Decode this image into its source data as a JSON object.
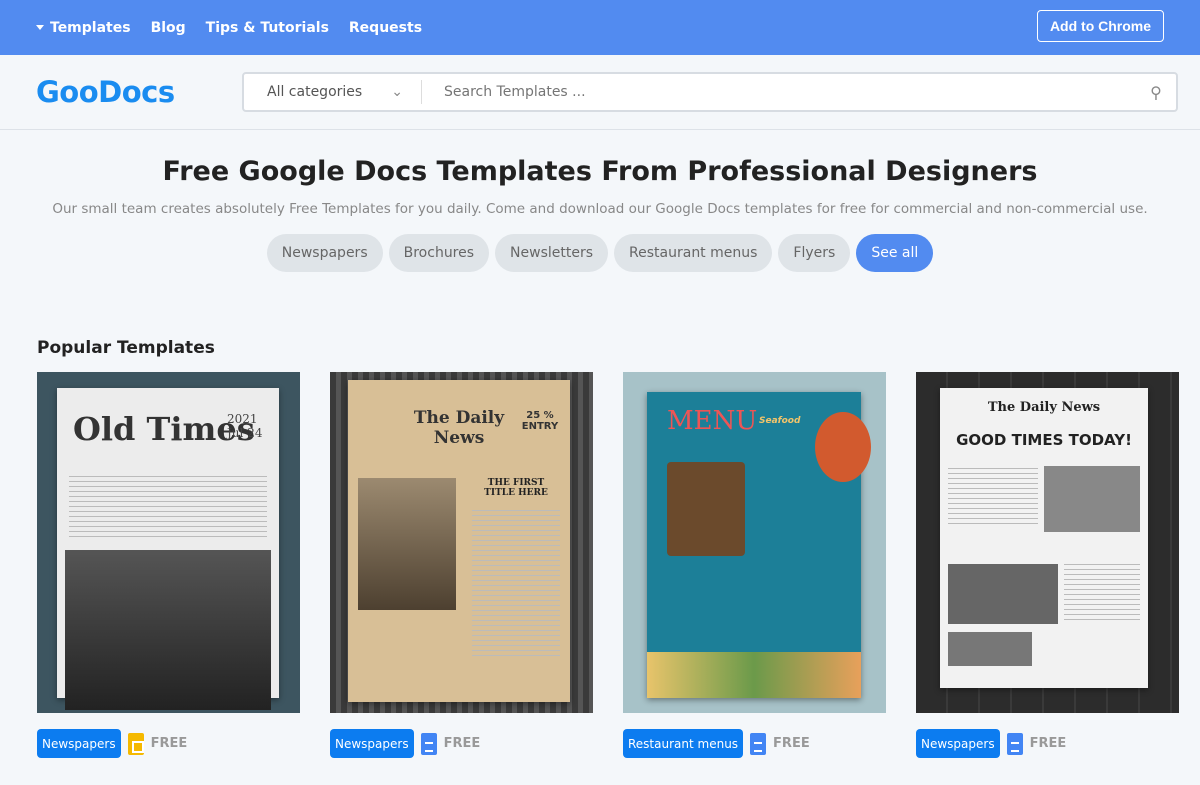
{
  "topbar": {
    "nav": [
      "Templates",
      "Blog",
      "Tips & Tutorials",
      "Requests"
    ],
    "cta": "Add to Chrome"
  },
  "header": {
    "logo": "GooDocs",
    "category": "All categories",
    "search_placeholder": "Search Templates ..."
  },
  "hero": {
    "title": "Free Google Docs Templates From Professional Designers",
    "subtitle": "Our small team creates absolutely Free Templates for you daily. Come and download our Google Docs templates for free for commercial and non-commercial use.",
    "pills": [
      "Newspapers",
      "Brochures",
      "Newsletters",
      "Restaurant menus",
      "Flyers",
      "See all"
    ]
  },
  "popular": {
    "title": "Popular Templates",
    "free_label": "FREE",
    "cards": [
      {
        "thumb_title": "Old Times",
        "thumb_date": "2021 Jul 24",
        "tag": "Newspapers",
        "doc_type": "slides",
        "doc_color": "#f5b900"
      },
      {
        "thumb_title": "The Daily News",
        "thumb_sub": "THE FIRST TITLE HERE",
        "thumb_badge": "25 % ENTRY",
        "tag": "Newspapers",
        "doc_type": "docs",
        "doc_color": "#4285f4"
      },
      {
        "thumb_title": "MENU",
        "thumb_sub": "Seafood",
        "tag": "Restaurant menus",
        "doc_type": "docs",
        "doc_color": "#4285f4"
      },
      {
        "thumb_title": "The Daily News",
        "thumb_sub": "GOOD TIMES TODAY!",
        "tag": "Newspapers",
        "doc_type": "docs",
        "doc_color": "#4285f4"
      }
    ]
  }
}
